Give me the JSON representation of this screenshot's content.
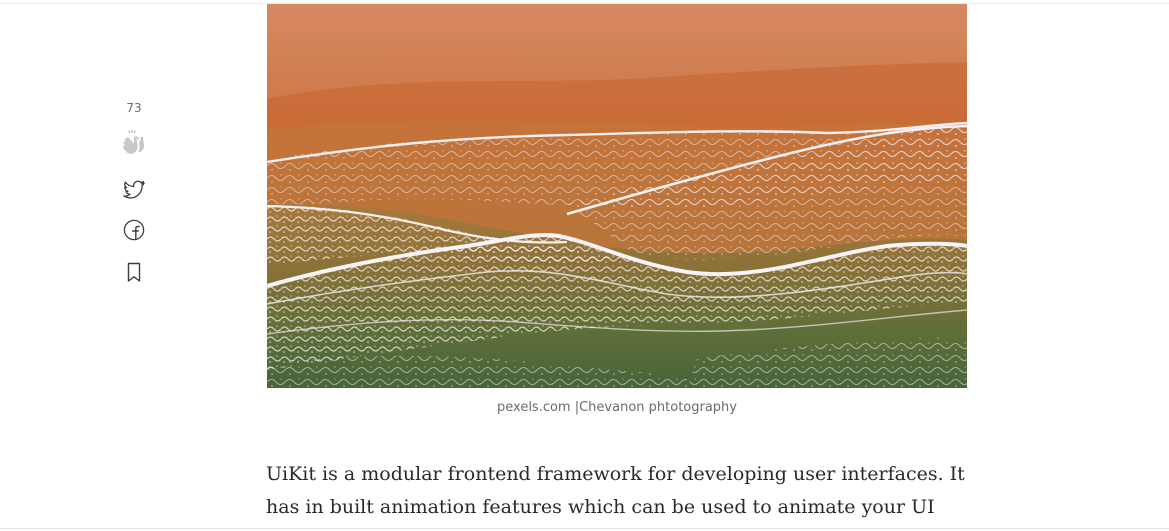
{
  "side_actions": {
    "clap_count": "73",
    "icons": {
      "clap": "clap-icon",
      "twitter": "twitter-icon",
      "facebook": "facebook-icon",
      "bookmark": "bookmark-icon"
    }
  },
  "figure": {
    "image_subject": "aerial view of beach waves",
    "caption": "pexels.com |Chevanon phtotography"
  },
  "article": {
    "paragraph": "UiKit is a modular frontend framework for developing user interfaces. It has in built animation features which can be used to animate your UI components."
  },
  "colors": {
    "text": "#292929",
    "muted": "#6b6b6b",
    "sand": "#d9844a",
    "sea": "#4f6e3a",
    "foam": "#f2eef0"
  }
}
